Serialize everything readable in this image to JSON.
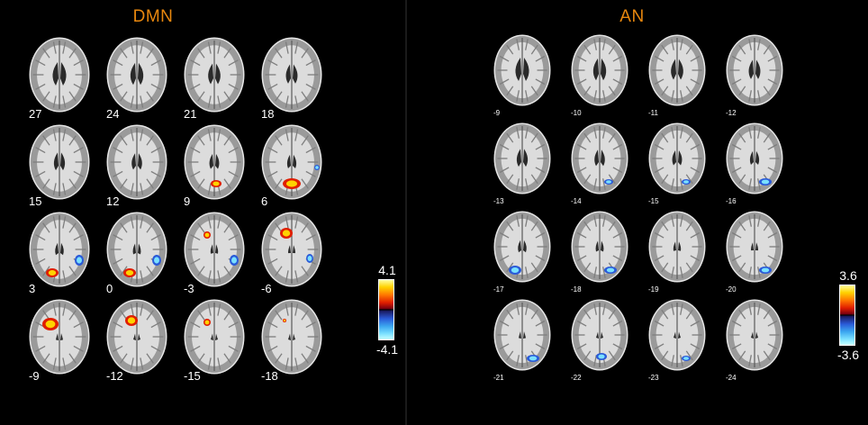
{
  "colors": {
    "title": "#e8870e",
    "positive": [
      "#ffffa0",
      "#ffd200",
      "#ff7800",
      "#e01e00",
      "#7a0010"
    ],
    "negative": [
      "#1a1a60",
      "#2a5ad8",
      "#3ca8f0",
      "#7ae0ff",
      "#c8ffff"
    ]
  },
  "dmn": {
    "title": "DMN",
    "slices": [
      {
        "label": "27",
        "pos": [],
        "neg": []
      },
      {
        "label": "24",
        "pos": [],
        "neg": []
      },
      {
        "label": "21",
        "pos": [],
        "neg": []
      },
      {
        "label": "18",
        "pos": [],
        "neg": []
      },
      {
        "label": "15",
        "pos": [],
        "neg": []
      },
      {
        "label": "12",
        "pos": [],
        "neg": []
      },
      {
        "label": "9",
        "pos": [
          "occipital-mid"
        ],
        "neg": []
      },
      {
        "label": "6",
        "pos": [
          "occipital-mid-large"
        ],
        "neg": [
          "right-lateral-small"
        ]
      },
      {
        "label": "3",
        "pos": [
          "occipital-left"
        ],
        "neg": [
          "right-temporal"
        ]
      },
      {
        "label": "0",
        "pos": [
          "occipital-left"
        ],
        "neg": [
          "right-temporal"
        ]
      },
      {
        "label": "-3",
        "pos": [
          "frontal-left-small"
        ],
        "neg": [
          "right-temporal"
        ]
      },
      {
        "label": "-6",
        "pos": [
          "frontal-left"
        ],
        "neg": [
          "right-temporal-small"
        ]
      },
      {
        "label": "-9",
        "pos": [
          "frontal-left-large"
        ],
        "neg": []
      },
      {
        "label": "-12",
        "pos": [
          "frontal-left"
        ],
        "neg": []
      },
      {
        "label": "-15",
        "pos": [
          "frontal-left-small"
        ],
        "neg": []
      },
      {
        "label": "-18",
        "pos": [
          "frontal-left-tiny"
        ],
        "neg": []
      }
    ],
    "colorbar": {
      "max": "4.1",
      "min": "-4.1"
    }
  },
  "an": {
    "title": "AN",
    "slices": [
      {
        "label": "-9",
        "pos": [],
        "neg": []
      },
      {
        "label": "-10",
        "pos": [],
        "neg": []
      },
      {
        "label": "-11",
        "pos": [],
        "neg": []
      },
      {
        "label": "-12",
        "pos": [],
        "neg": []
      },
      {
        "label": "-13",
        "pos": [],
        "neg": []
      },
      {
        "label": "-14",
        "pos": [],
        "neg": [
          "occipital-right-small"
        ]
      },
      {
        "label": "-15",
        "pos": [],
        "neg": [
          "occipital-right-small"
        ]
      },
      {
        "label": "-16",
        "pos": [],
        "neg": [
          "occipital-right"
        ]
      },
      {
        "label": "-17",
        "pos": [],
        "neg": [
          "occipital-left"
        ]
      },
      {
        "label": "-18",
        "pos": [],
        "neg": [
          "occipital-right"
        ]
      },
      {
        "label": "-19",
        "pos": [],
        "neg": []
      },
      {
        "label": "-20",
        "pos": [],
        "neg": [
          "occipital-right"
        ]
      },
      {
        "label": "-21",
        "pos": [],
        "neg": [
          "occipital-right"
        ]
      },
      {
        "label": "-22",
        "pos": [],
        "neg": [
          "occipital-mid"
        ]
      },
      {
        "label": "-23",
        "pos": [],
        "neg": [
          "occipital-right-small"
        ]
      },
      {
        "label": "-24",
        "pos": [],
        "neg": []
      }
    ],
    "colorbar": {
      "max": "3.6",
      "min": "-3.6"
    }
  }
}
